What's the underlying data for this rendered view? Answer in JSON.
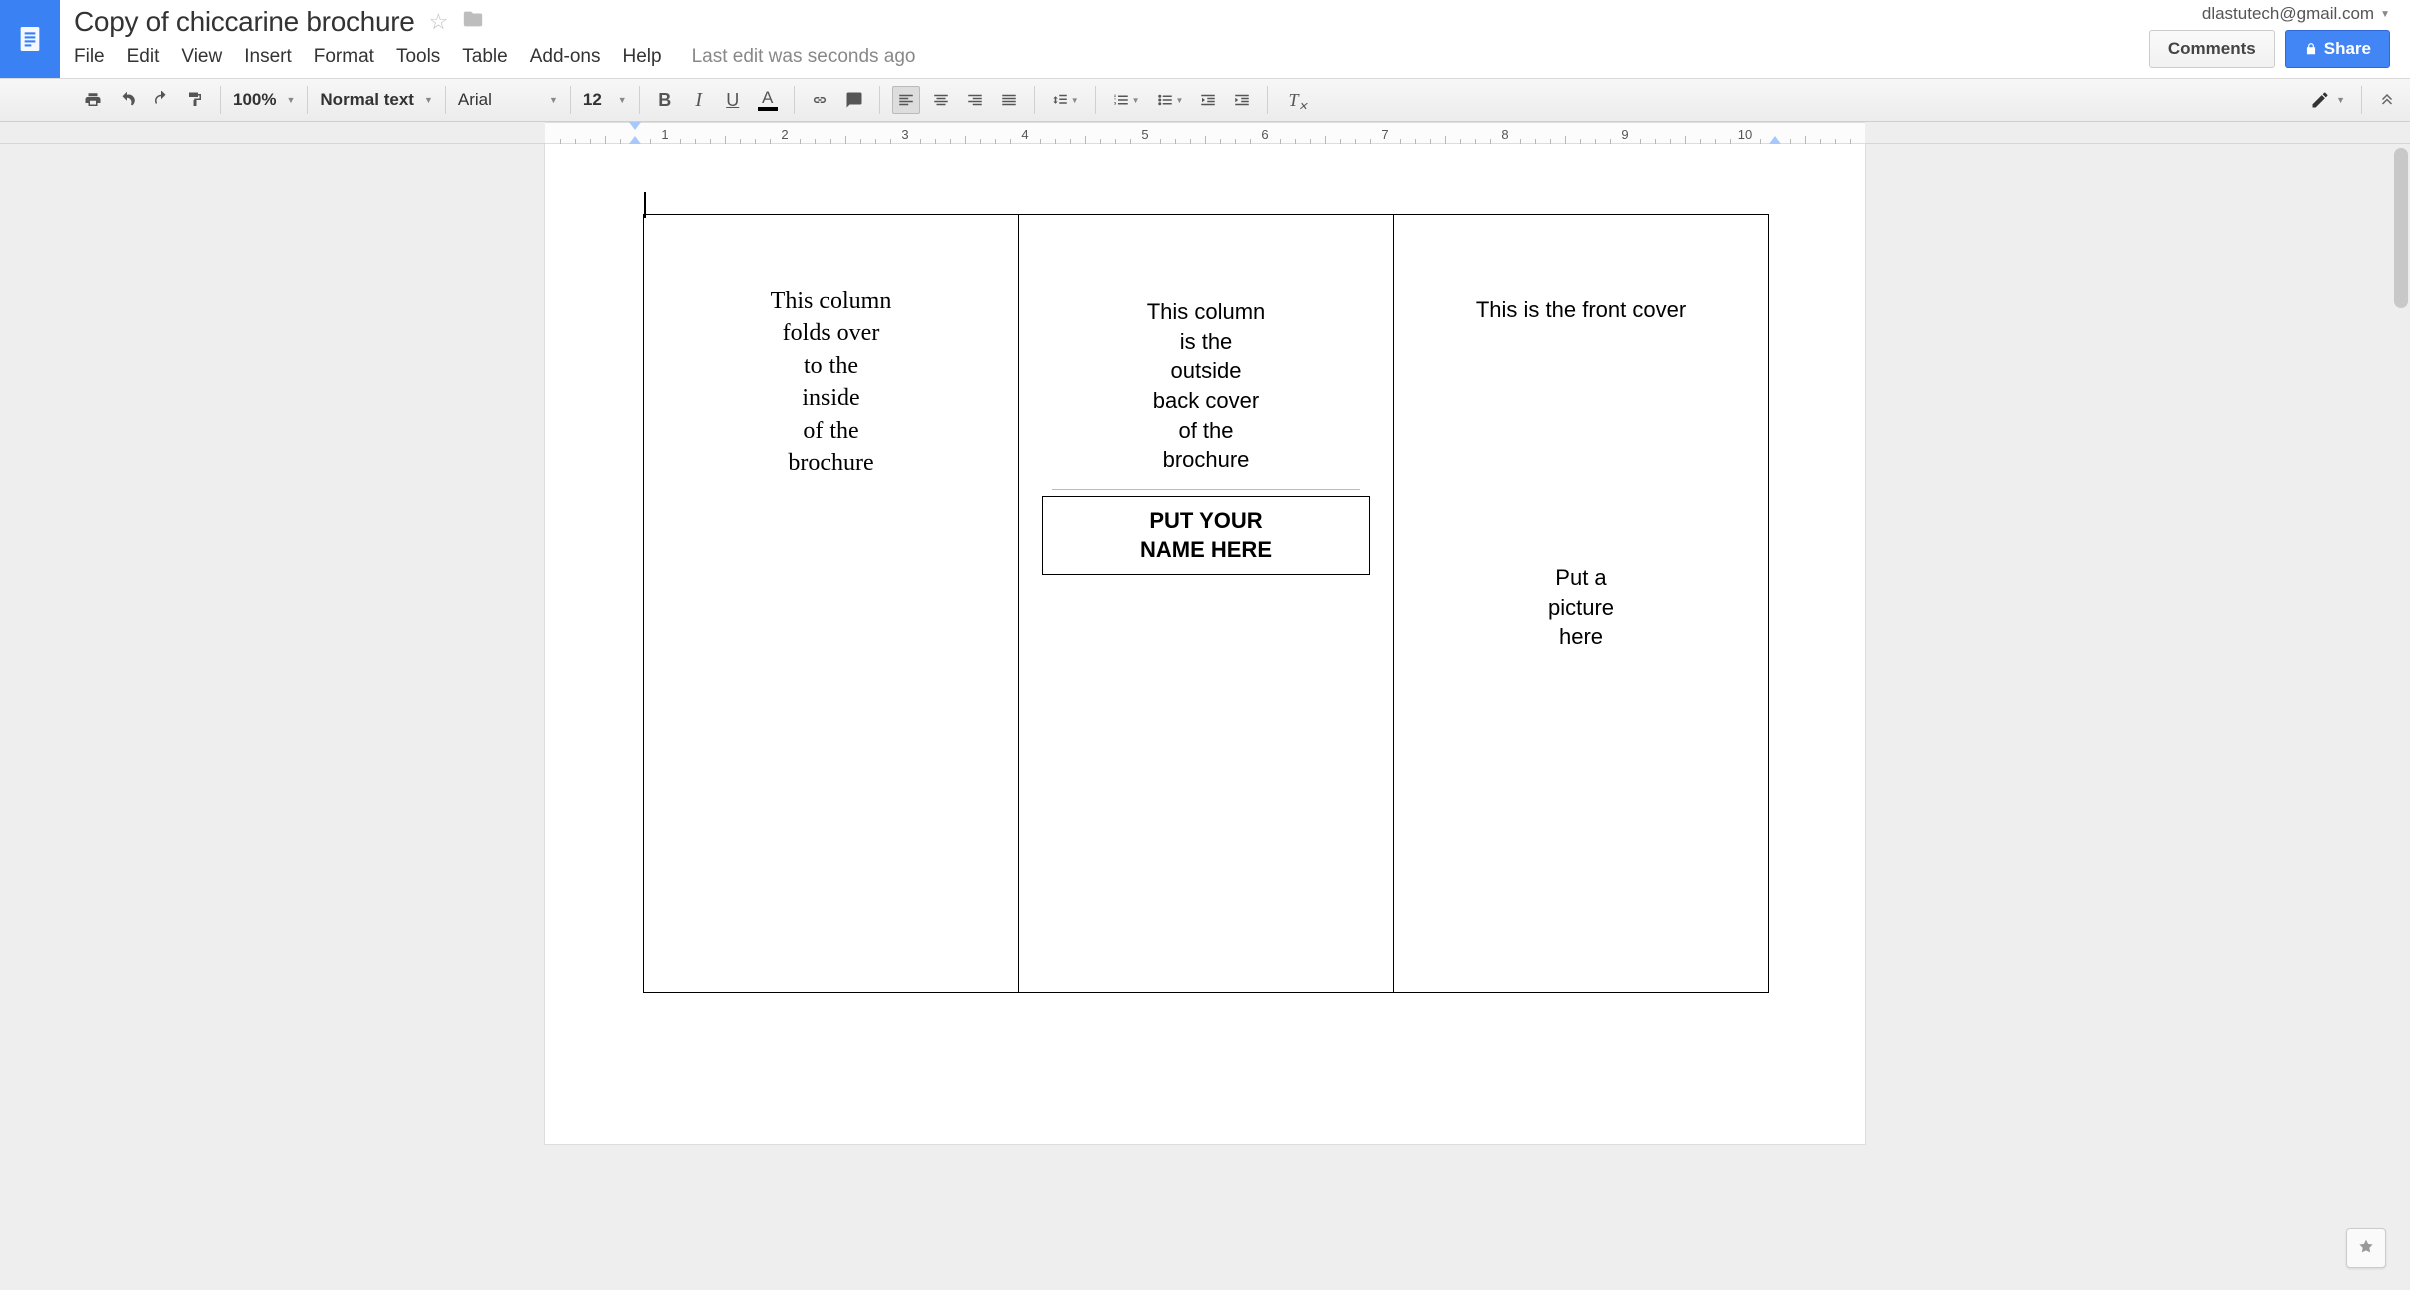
{
  "account": {
    "email": "dlastutech@gmail.com"
  },
  "doc": {
    "title": "Copy of chiccarine brochure"
  },
  "menus": {
    "file": "File",
    "edit": "Edit",
    "view": "View",
    "insert": "Insert",
    "format": "Format",
    "tools": "Tools",
    "table": "Table",
    "addons": "Add-ons",
    "help": "Help",
    "last_edit": "Last edit was seconds ago"
  },
  "buttons": {
    "comments": "Comments",
    "share": "Share"
  },
  "toolbar": {
    "zoom": "100%",
    "paragraph_style": "Normal text",
    "font": "Arial",
    "font_size": "12"
  },
  "ruler": {
    "numbers": [
      1,
      2,
      3,
      4,
      5,
      6,
      7,
      8,
      9,
      10
    ]
  },
  "content": {
    "col1_lines": [
      "This column",
      "folds over",
      "to the",
      "inside",
      "of the",
      "brochure"
    ],
    "col2_lines": [
      "This column",
      "is the",
      "outside",
      "back cover",
      "of the",
      "brochure"
    ],
    "col2_box_lines": [
      "PUT YOUR",
      "NAME HERE"
    ],
    "col3_title": "This is the front cover",
    "col3_pic_lines": [
      "Put a",
      "picture",
      "here"
    ]
  }
}
